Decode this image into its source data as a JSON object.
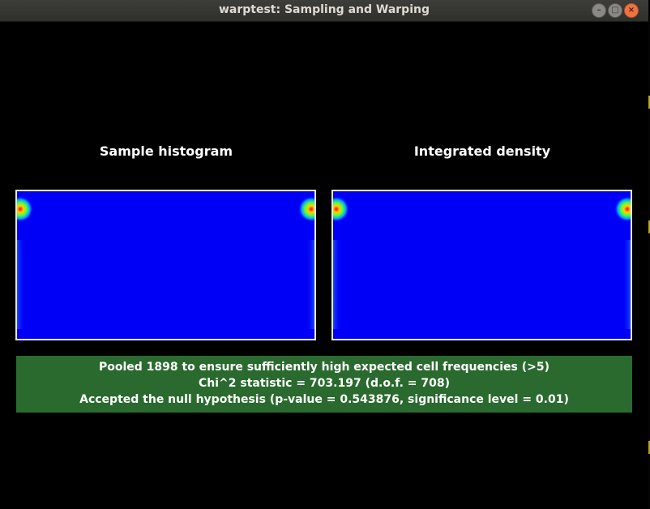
{
  "window": {
    "title": "warptest: Sampling and Warping"
  },
  "panels": {
    "left_label": "Sample histogram",
    "right_label": "Integrated density"
  },
  "results": {
    "line1": "Pooled 1898 to ensure sufficiently high expected cell frequencies (>5)",
    "line2": "Chi^2 statistic = 703.197 (d.o.f. = 708)",
    "line3": "Accepted the null hypothesis (p-value = 0.543876, significance level = 0.01)"
  },
  "colors": {
    "plot_background": "#0000f6",
    "result_background": "#2a6a2f",
    "heat_peak": "#ff0000"
  }
}
